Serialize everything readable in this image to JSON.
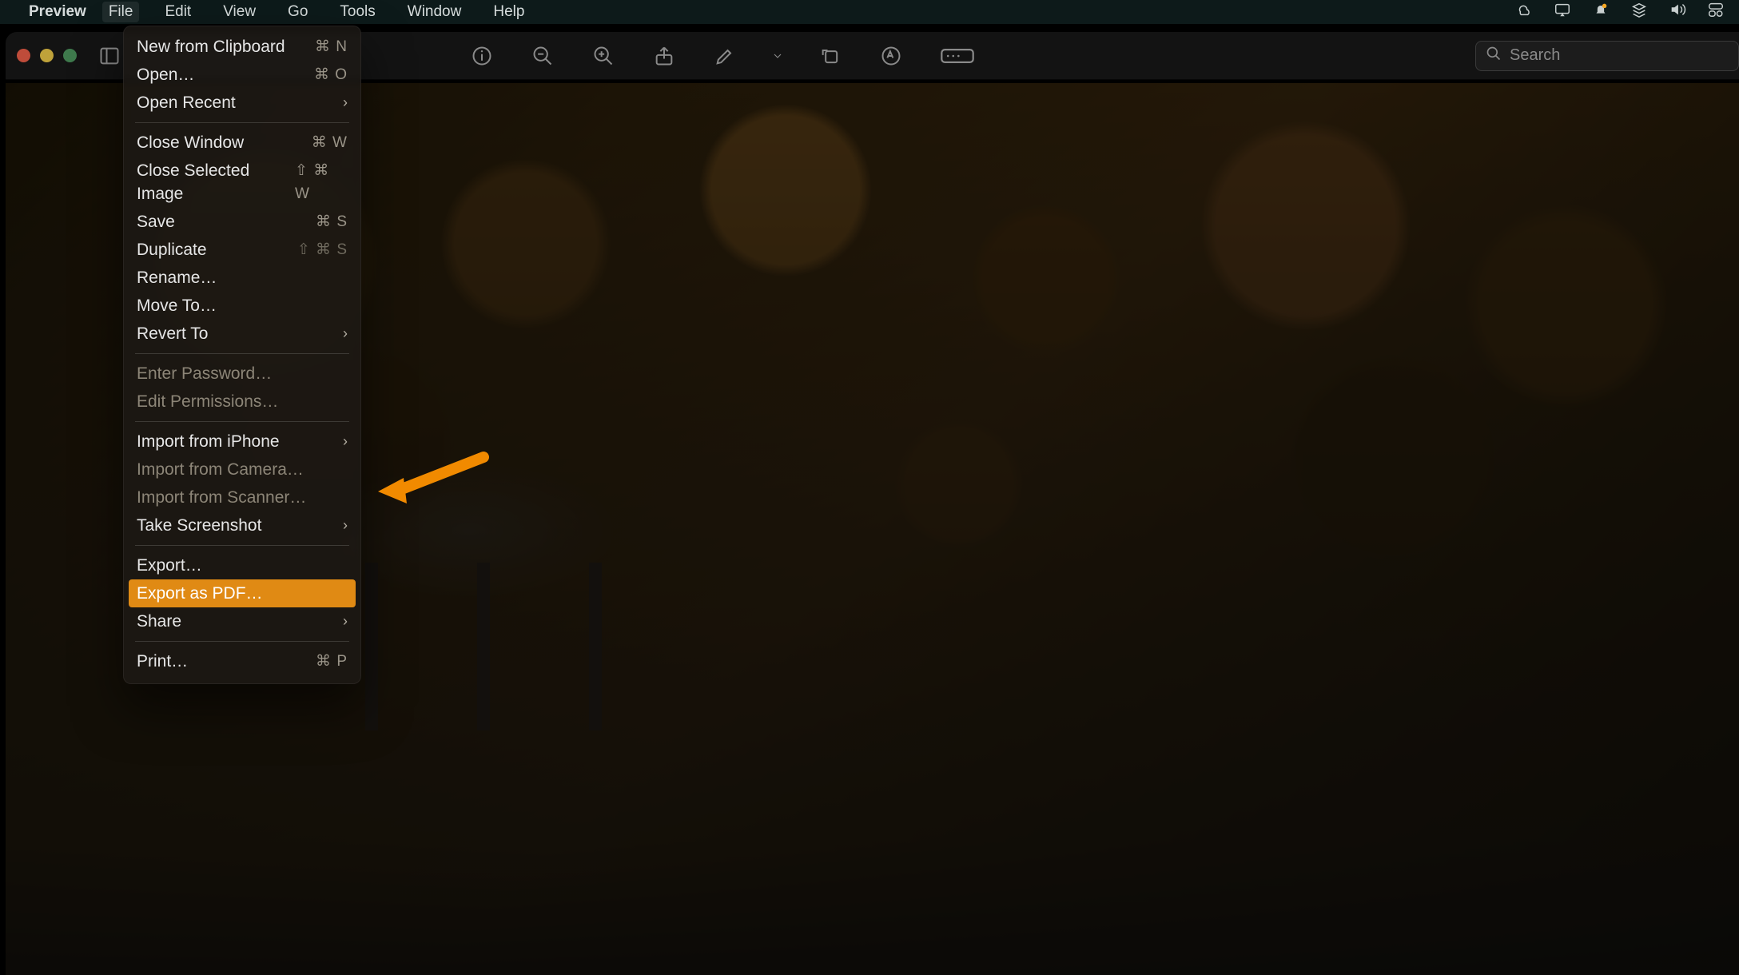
{
  "menubar": {
    "app": "Preview",
    "items": [
      "File",
      "Edit",
      "View",
      "Go",
      "Tools",
      "Window",
      "Help"
    ],
    "active": "File"
  },
  "toolbar": {
    "search_placeholder": "Search"
  },
  "menu": {
    "sections": [
      [
        {
          "label": "New from Clipboard",
          "shortcut": "⌘ N"
        },
        {
          "label": "Open…",
          "shortcut": "⌘ O"
        },
        {
          "label": "Open Recent",
          "submenu": true
        }
      ],
      [
        {
          "label": "Close Window",
          "shortcut": "⌘ W"
        },
        {
          "label": "Close Selected Image",
          "shortcut": "⇧ ⌘ W"
        },
        {
          "label": "Save",
          "shortcut": "⌘ S"
        },
        {
          "label": "Duplicate",
          "shortcut": "⇧ ⌘ S",
          "shortcut_dim": true
        },
        {
          "label": "Rename…"
        },
        {
          "label": "Move To…"
        },
        {
          "label": "Revert To",
          "submenu": true
        }
      ],
      [
        {
          "label": "Enter Password…",
          "disabled": true
        },
        {
          "label": "Edit Permissions…",
          "disabled": true
        }
      ],
      [
        {
          "label": "Import from iPhone",
          "submenu": true
        },
        {
          "label": "Import from Camera…",
          "disabled": true
        },
        {
          "label": "Import from Scanner…",
          "disabled": true
        },
        {
          "label": "Take Screenshot",
          "submenu": true
        }
      ],
      [
        {
          "label": "Export…"
        },
        {
          "label": "Export as PDF…",
          "highlight": true
        },
        {
          "label": "Share",
          "submenu": true
        }
      ],
      [
        {
          "label": "Print…",
          "shortcut": "⌘ P"
        }
      ]
    ]
  }
}
